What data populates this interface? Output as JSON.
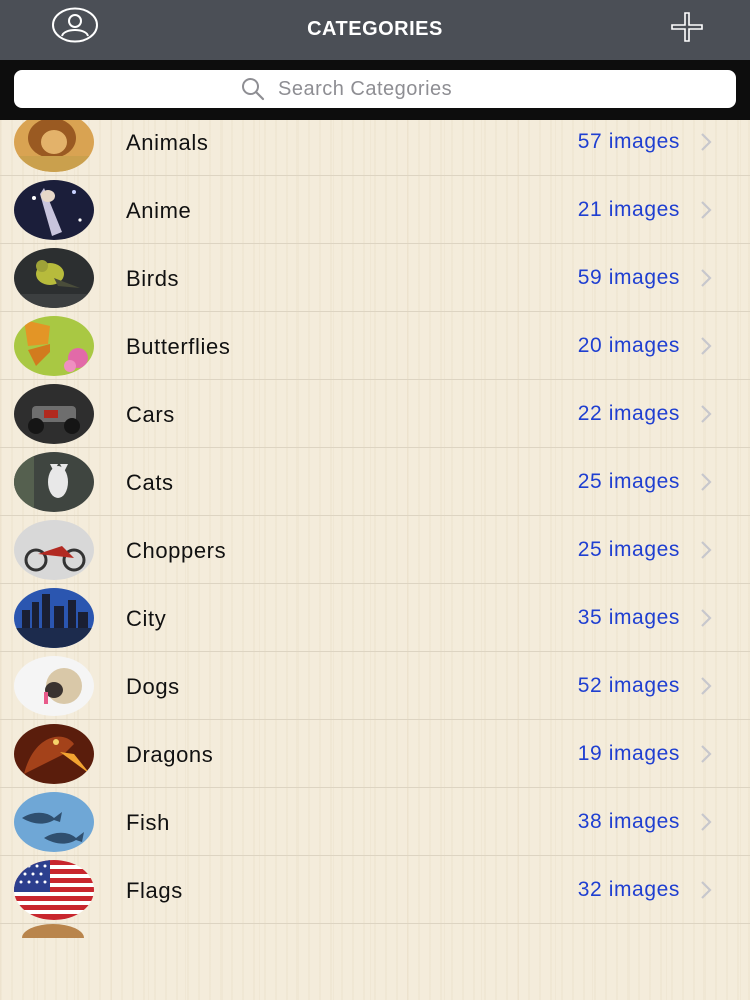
{
  "header": {
    "title": "CATEGORIES"
  },
  "search": {
    "placeholder": "Search Categories"
  },
  "categories": [
    {
      "name": "Animals",
      "count": "57 images"
    },
    {
      "name": "Anime",
      "count": "21 images"
    },
    {
      "name": "Birds",
      "count": "59 images"
    },
    {
      "name": "Butterflies",
      "count": "20 images"
    },
    {
      "name": "Cars",
      "count": "22 images"
    },
    {
      "name": "Cats",
      "count": "25 images"
    },
    {
      "name": "Choppers",
      "count": "25 images"
    },
    {
      "name": "City",
      "count": "35 images"
    },
    {
      "name": "Dogs",
      "count": "52 images"
    },
    {
      "name": "Dragons",
      "count": "19 images"
    },
    {
      "name": "Fish",
      "count": "38 images"
    },
    {
      "name": "Flags",
      "count": "32 images"
    }
  ],
  "colors": {
    "navbar": "#4b4f56",
    "count_text": "#1f3fd1",
    "background": "#f4ecdb"
  }
}
